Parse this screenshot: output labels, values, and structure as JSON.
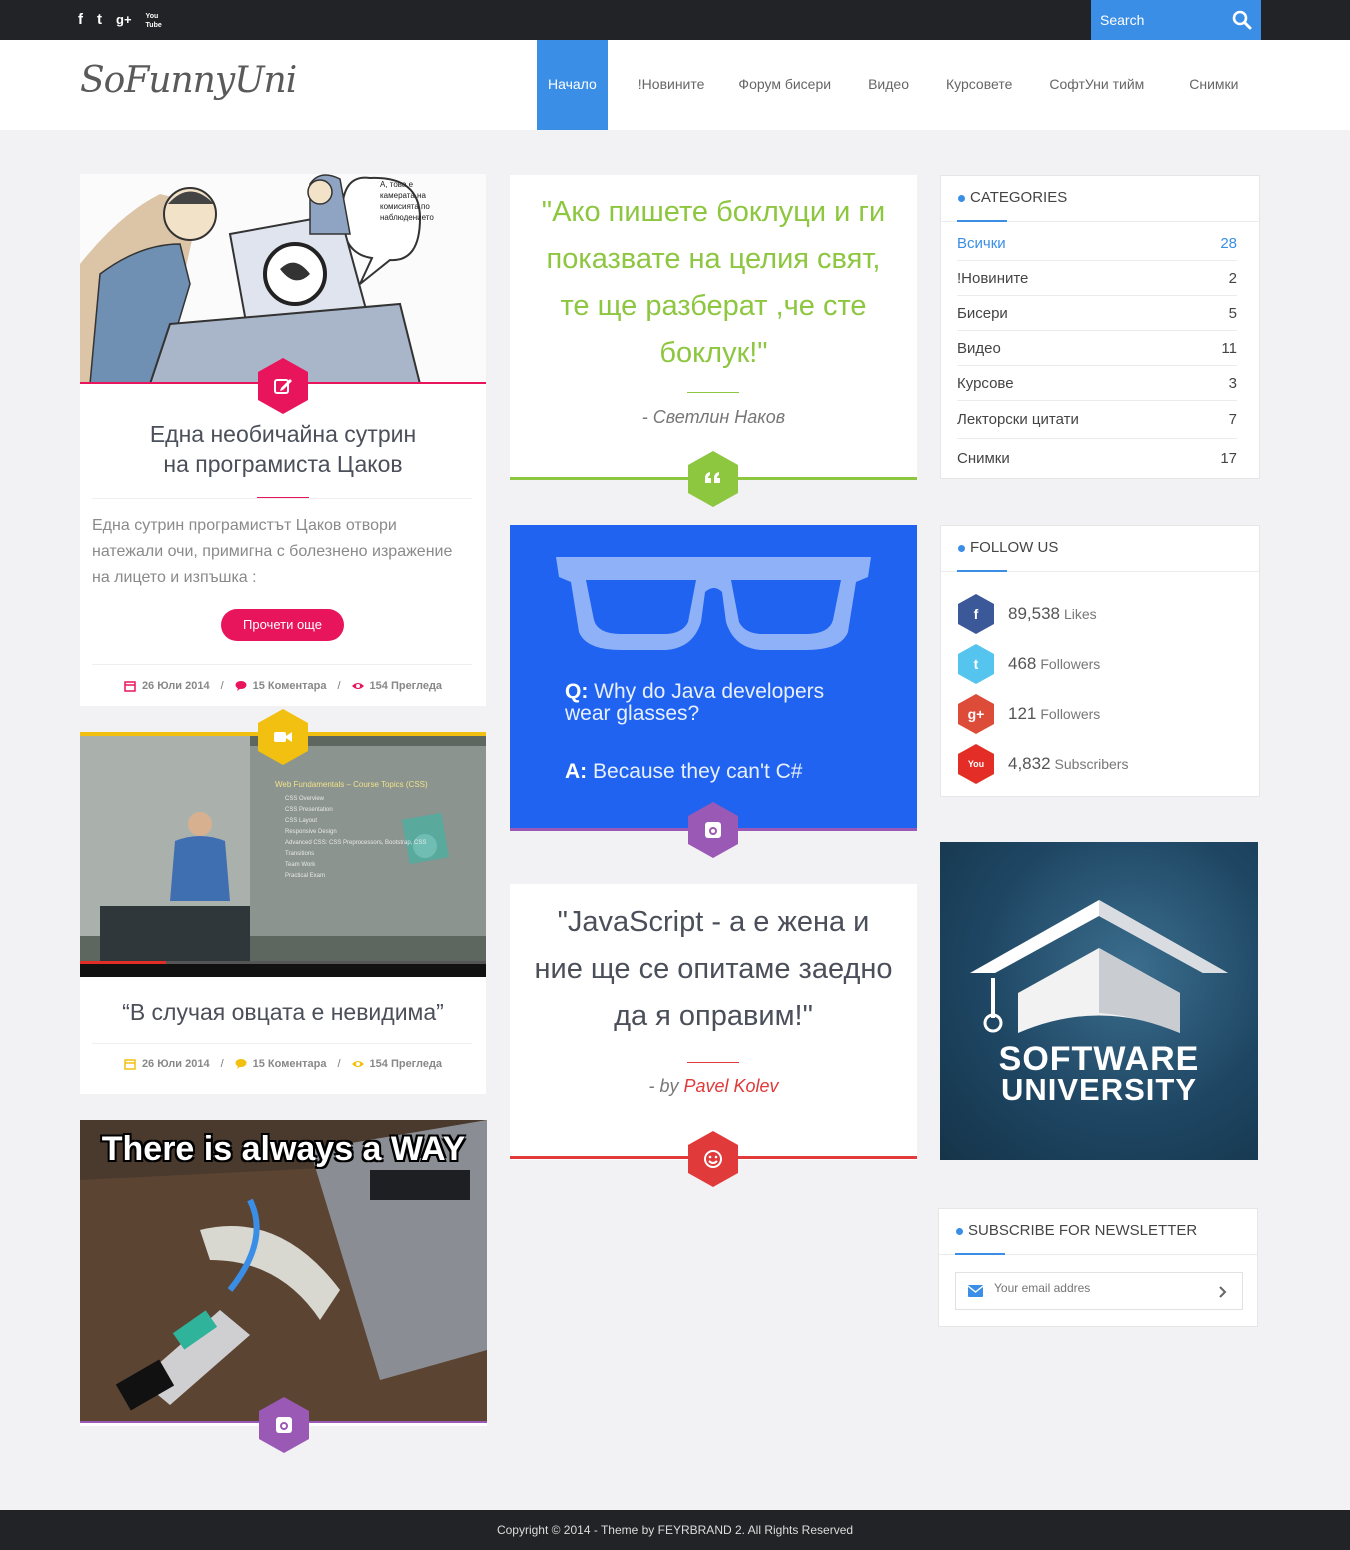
{
  "topbar": {
    "social": [
      {
        "glyph": "f",
        "icon": "facebook-icon"
      },
      {
        "glyph": "t",
        "icon": "twitter-icon"
      },
      {
        "glyph": "g+",
        "icon": "google-plus-icon"
      },
      {
        "glyph": "You Tube",
        "icon": "youtube-icon"
      }
    ],
    "search_placeholder": "Search"
  },
  "header": {
    "logo": "SoFunnyUni",
    "nav": [
      "Начало",
      "!Новините",
      "Форум бисери",
      "Видео",
      "Курсовете",
      "СофтУни тийм",
      "Снимки"
    ]
  },
  "colors": {
    "accent": "#3a8ee6",
    "pink": "#e8155c",
    "yellow": "#f2c010",
    "green": "#8dc63f",
    "purple": "#9b59b6",
    "red": "#e03a3a"
  },
  "posts": {
    "post1": {
      "title_line1": "Една необичайна сутрин",
      "title_line2": "на програмиста Цаков",
      "excerpt": "Една сутрин програмистът Цаков отвори натежали очи, примигна с болезнено изражение на лицето и изпъшка :",
      "read_more": "Прочети още",
      "date": "26 Юли 2014",
      "comments": "15 Коментара",
      "views": "154 Прегледа",
      "speech_bubble": "А, това е камерата на комисията по наблюдението"
    },
    "post2": {
      "title": "“В случая овцата е невидима”",
      "date": "26 Юли 2014",
      "comments": "15 Коментара",
      "views": "154 Прегледа",
      "slide_title": "Web Fundamentals – Course Topics (CSS)",
      "slide_items": [
        "CSS Overview",
        "CSS Presentation",
        "CSS Layout",
        "Responsive Design",
        "Advanced CSS: CSS Preprocessors, Bootstrap, CSS Transitions",
        "Team Work",
        "Practical Exam"
      ]
    },
    "post3": {
      "image_caption": "There is always a WAY"
    },
    "quote1": {
      "text": "\"Ако пишете боклуци и ги показвате на целия свят, те ще разберат ,че сте боклук!\"",
      "author": "- Светлин Наков"
    },
    "image_quote": {
      "q_label": "Q:",
      "q_text": "Why do Java developers wear glasses?",
      "a_label": "A:",
      "a_text": "Because they can't C#"
    },
    "quote2": {
      "text": "\"JavaScript - а е жена и ние ще се опитаме заедно да я оправим!\"",
      "author_prefix": "- by ",
      "author_name": "Pavel Kolev"
    }
  },
  "sidebar": {
    "categories": {
      "title": "CATEGORIES",
      "items": [
        {
          "label": "Всички",
          "count": "28"
        },
        {
          "label": "!Новините",
          "count": "2"
        },
        {
          "label": "Бисери",
          "count": "5"
        },
        {
          "label": "Видео",
          "count": "11"
        },
        {
          "label": "Курсове",
          "count": "3"
        },
        {
          "label": "Лекторски цитати",
          "count": "7"
        },
        {
          "label": "Снимки",
          "count": "17"
        }
      ]
    },
    "follow": {
      "title": "FOLLOW US",
      "items": [
        {
          "num": "89,538",
          "label": "Likes",
          "glyph": "f",
          "color": "#3b5998"
        },
        {
          "num": "468",
          "label": "Followers",
          "glyph": "t",
          "color": "#55c5ef"
        },
        {
          "num": "121",
          "label": "Followers",
          "glyph": "g+",
          "color": "#dd4b39"
        },
        {
          "num": "4,832",
          "label": "Subscribers",
          "glyph": "You",
          "color": "#e52d27"
        }
      ]
    },
    "banner": {
      "line1": "SOFTWARE",
      "line2": "UNIVERSITY"
    },
    "newsletter": {
      "title": "SUBSCRIBE FOR NEWSLETTER",
      "placeholder": "Your email addres"
    }
  },
  "footer": {
    "text": "Copyright © 2014 - Theme by FEYRBRAND 2. All Rights Reserved"
  }
}
